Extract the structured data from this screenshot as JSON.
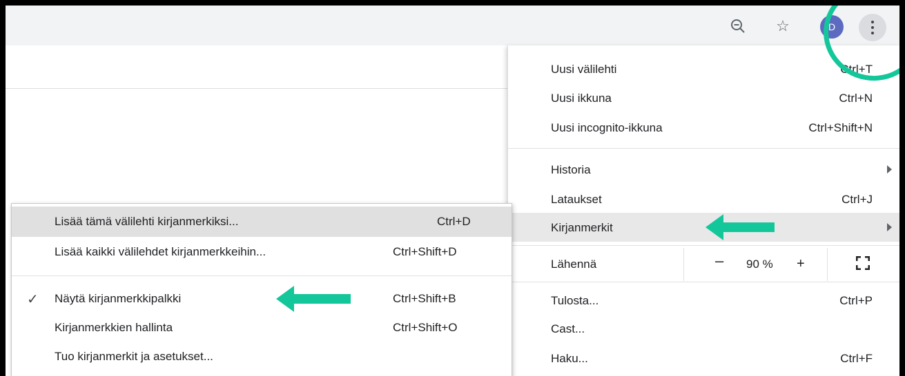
{
  "toolbar": {
    "avatar_letter": "D"
  },
  "main_menu": {
    "items": [
      {
        "label": "Uusi välilehti",
        "shortcut": "Ctrl+T"
      },
      {
        "label": "Uusi ikkuna",
        "shortcut": "Ctrl+N"
      },
      {
        "label": "Uusi incognito-ikkuna",
        "shortcut": "Ctrl+Shift+N"
      },
      {
        "label": "Historia",
        "shortcut": ""
      },
      {
        "label": "Lataukset",
        "shortcut": "Ctrl+J"
      },
      {
        "label": "Kirjanmerkit",
        "shortcut": ""
      },
      {
        "label": "Lähennä",
        "shortcut": ""
      },
      {
        "label": "Tulosta...",
        "shortcut": "Ctrl+P"
      },
      {
        "label": "Cast...",
        "shortcut": ""
      },
      {
        "label": "Haku...",
        "shortcut": "Ctrl+F"
      }
    ],
    "zoom": {
      "minus": "–",
      "value": "90 %",
      "plus": "+"
    }
  },
  "sub_menu": {
    "items": [
      {
        "label": "Lisää tämä välilehti kirjanmerkiksi...",
        "shortcut": "Ctrl+D"
      },
      {
        "label": "Lisää kaikki välilehdet kirjanmerkkeihin...",
        "shortcut": "Ctrl+Shift+D"
      },
      {
        "label": "Näytä kirjanmerkkipalkki",
        "shortcut": "Ctrl+Shift+B",
        "check": "✓"
      },
      {
        "label": "Kirjanmerkkien hallinta",
        "shortcut": "Ctrl+Shift+O"
      },
      {
        "label": "Tuo kirjanmerkit ja asetukset...",
        "shortcut": ""
      }
    ]
  },
  "colors": {
    "highlight": "#13c79a",
    "avatar": "#5c6bc0"
  }
}
